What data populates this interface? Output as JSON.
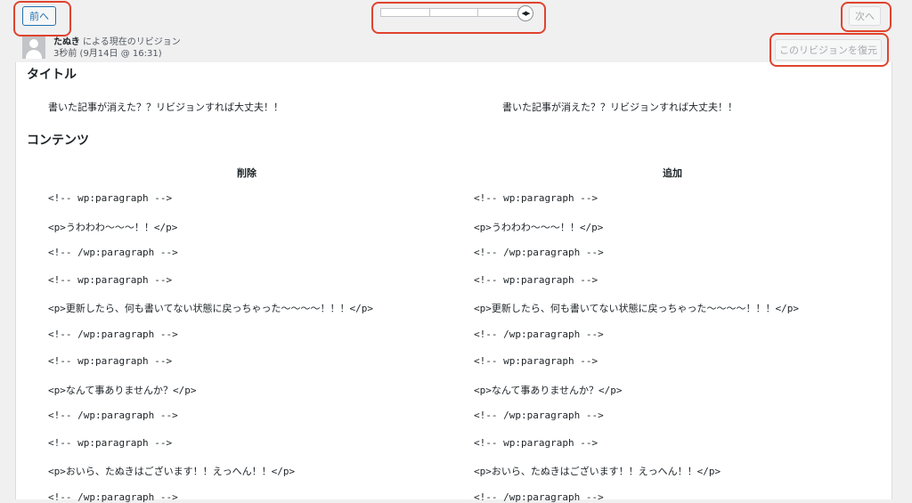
{
  "nav": {
    "prev_label": "前へ",
    "next_label": "次へ"
  },
  "slider": {
    "position": "last",
    "handle_icon": "arrows-left-right-icon"
  },
  "revision": {
    "author": "たぬき",
    "author_suffix": " による現在のリビジョン",
    "time": "3秒前 (9月14日 @ 16:31)"
  },
  "restore_label": "このリビジョンを復元",
  "title_section": {
    "heading": "タイトル",
    "left": "書いた記事が消えた？？リビジョンすれば大丈夫！！",
    "right": "書いた記事が消えた？？リビジョンすれば大丈夫！！"
  },
  "content_section": {
    "heading": "コンテンツ",
    "left_header": "削除",
    "right_header": "追加",
    "rows": [
      {
        "left": "<!-- wp:paragraph -->",
        "right": "<!-- wp:paragraph -->"
      },
      {
        "left": "<p>うわわわ〜〜〜！！</p>",
        "right": "<p>うわわわ〜〜〜！！</p>"
      },
      {
        "left": "<!-- /wp:paragraph -->",
        "right": "<!-- /wp:paragraph -->"
      },
      {
        "left": "<!-- wp:paragraph -->",
        "right": "<!-- wp:paragraph -->"
      },
      {
        "left": "<p>更新したら、何も書いてない状態に戻っちゃった〜〜〜〜！！！</p>",
        "right": "<p>更新したら、何も書いてない状態に戻っちゃった〜〜〜〜！！！</p>"
      },
      {
        "left": "<!-- /wp:paragraph -->",
        "right": "<!-- /wp:paragraph -->"
      },
      {
        "left": "<!-- wp:paragraph -->",
        "right": "<!-- wp:paragraph -->"
      },
      {
        "left": "<p>なんて事ありませんか？</p>",
        "right": "<p>なんて事ありませんか？</p>"
      },
      {
        "left": "<!-- /wp:paragraph -->",
        "right": "<!-- /wp:paragraph -->"
      },
      {
        "left": "<!-- wp:paragraph -->",
        "right": "<!-- wp:paragraph -->"
      },
      {
        "left": "<p>おいら、たぬきはございます！！えっへん！！</p>",
        "right": "<p>おいら、たぬきはございます！！えっへん！！</p>"
      },
      {
        "left": "<!-- /wp:paragraph -->",
        "right": "<!-- /wp:paragraph -->"
      }
    ]
  },
  "annotation_color": "#e0432e"
}
